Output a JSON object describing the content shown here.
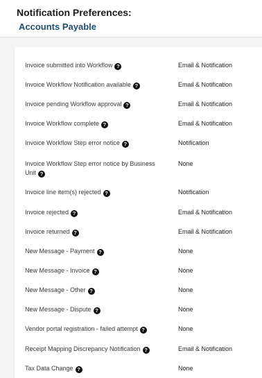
{
  "header": {
    "title": "Notification Preferences:",
    "subtitle": "Accounts Payable"
  },
  "icons": {
    "help": "question-circle-icon"
  },
  "rows": [
    {
      "label": "Invoice submitted into Workflow",
      "value": "Email & Notification"
    },
    {
      "label": "Invoice Workflow Notification available",
      "value": "Email & Notification"
    },
    {
      "label": "Invoice pending Workflow approval",
      "value": "Email & Notification"
    },
    {
      "label": "Invoice Workflow complete",
      "value": "Email & Notification"
    },
    {
      "label": "Invoice Workflow Step error notice",
      "value": "Notification"
    },
    {
      "label": "Invoice Workflow Step error notice by Business Unit",
      "value": "None"
    },
    {
      "label": "Invoice line item(s) rejected",
      "value": "Notification"
    },
    {
      "label": "Invoice rejected",
      "value": "Email & Notification"
    },
    {
      "label": "Invoice returned",
      "value": "Email & Notification"
    },
    {
      "label": "New Message - Payment",
      "value": "None"
    },
    {
      "label": "New Message - Invoice",
      "value": "None"
    },
    {
      "label": "New Message - Other",
      "value": "None"
    },
    {
      "label": "New Message - Dispute",
      "value": "None"
    },
    {
      "label": "Vendor portal registration - failed attempt",
      "value": "None"
    },
    {
      "label": "Receipt Mapping Discrepancy Notification",
      "value": "Email & Notification"
    },
    {
      "label": "Tax Data Change",
      "value": "None"
    }
  ]
}
